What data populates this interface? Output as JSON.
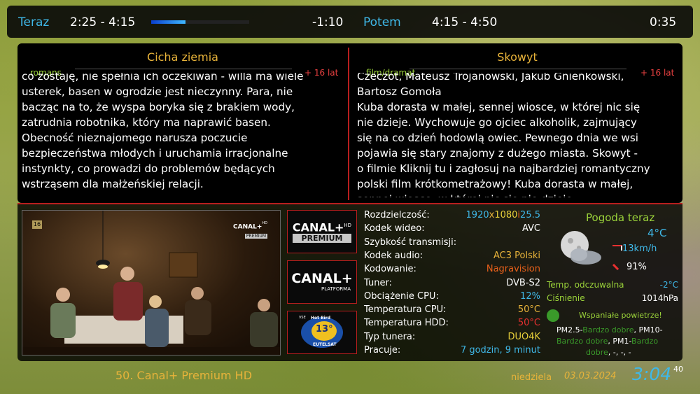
{
  "top": {
    "now_label": "Teraz",
    "now_time": "2:25 -  4:15",
    "progress": 0.35,
    "remaining": "-1:10",
    "next_label": "Potem",
    "next_time": "4:15 -  4:50",
    "next_duration": "0:35"
  },
  "now_event": {
    "title": "Cicha ziemia",
    "genre": "romans",
    "age": "+ 16 lat",
    "description": [
      "co zostaję, nie spełnia ich oczekiwań - willa ma wiele",
      "usterek, basen w ogrodzie jest nieczynny. Para, nie",
      "bacząc na to, że wyspa boryka się z brakiem wody,",
      "zatrudnia robotnika, który ma naprawić basen.",
      "Obecność nieznajomego narusza poczucie",
      "bezpieczeństwa młodych i uruchamia irracjonalne",
      "instynkty, co prowadzi do problemów będących",
      "wstrząsem dla małżeńskiej relacji."
    ]
  },
  "next_event": {
    "title": "Skowyt",
    "genre": "film/dramat",
    "age": "+ 16 lat",
    "description": [
      "Czeczot, Mateusz Trojanowski, Jakub Gnieńkowski,",
      "Bartosz  Gomoła",
      "Kuba dorasta w małej, sennej wiosce, w której nic się",
      "nie dzieje. Wychowuje go ojciec alkoholik, zajmujący",
      "się na co dzień hodowlą owiec. Pewnego dnia we wsi",
      "pojawia się stary znajomy z dużego miasta. Skowyt -",
      "o filmie Kliknij tu i zagłosuj na najbardziej romantyczny",
      "polski film krótkometrażowy! Kuba dorasta w małej,",
      "sennej wiosce, w której nic się nie dzieje."
    ]
  },
  "pip": {
    "badge": "16",
    "logo_line1": "CANAL+",
    "logo_sup": "HD",
    "logo_line2": "PREMIUM"
  },
  "logos": {
    "premium": {
      "line1": "CANAL+",
      "sup": "HD",
      "line2": "PREMIUM"
    },
    "platforma": {
      "line1": "CANAL+",
      "line2": "PLATFORMA"
    },
    "satellite": {
      "top": "Hot Bird",
      "deg": "13°",
      "band": "EUTELSAT",
      "short": "VSE"
    }
  },
  "tech": [
    {
      "label": "Rozdzielczość:",
      "value": ""
    },
    {
      "label": "Kodek wideo:",
      "value": "AVC",
      "color": "#ffffff"
    },
    {
      "label": "Szybkość transmisji:",
      "value": "",
      "color": "#ffffff"
    },
    {
      "label": "Kodek audio:",
      "value": "AC3 Polski",
      "color": "#e8b33a"
    },
    {
      "label": "Kodowanie:",
      "value": "Nagravision",
      "color": "#e8601a"
    },
    {
      "label": "Tuner:",
      "value": "DVB-S2",
      "color": "#ffffff"
    },
    {
      "label": "Obciążenie CPU:",
      "value": "12%",
      "color": "#3fb8e8"
    },
    {
      "label": "Temperatura CPU:",
      "value": "50°C",
      "color": "#e8b33a"
    },
    {
      "label": "Temperatura HDD:",
      "value": "50°C",
      "color": "#e83030"
    },
    {
      "label": "Typ tunera:",
      "value": "DUO4K",
      "color": "#e8d03a"
    },
    {
      "label": "Pracuje:",
      "value": "7 godzin, 9 minut",
      "color": "#3fb8e8"
    }
  ],
  "resolution": {
    "w": "1920",
    "x1": "x",
    "h": "1080",
    "i": "i",
    "fps": "25.5"
  },
  "weather": {
    "title": "Pogoda teraz",
    "temp": "4°C",
    "wind": "13km/h",
    "humidity": "91%",
    "feels_label": "Temp. odczuwalna",
    "feels_value": "-2°C",
    "pressure_label": "Ciśnienie",
    "pressure_value": "1014hPa",
    "air_label": "Wspaniałe powietrze!",
    "air_line1_a": "PM2.5-",
    "air_line1_b": "Bardzo dobre",
    "air_line1_c": ", PM10-",
    "air_line2_a": "Bardzo dobre",
    "air_line2_b": ", PM1-",
    "air_line2_c": "Bardzo",
    "air_line3_a": "dobre",
    "air_line3_b": ", -, -, -"
  },
  "footer": {
    "channel": "50. Canal+ Premium HD",
    "day": "niedziela",
    "date": "03.03.2024",
    "time": "3:04",
    "seconds": "40"
  },
  "colors": {
    "accent_blue": "#3fb8e8",
    "accent_gold": "#e8b33a",
    "divider_red": "#b81e1e",
    "green": "#9bd33a"
  }
}
